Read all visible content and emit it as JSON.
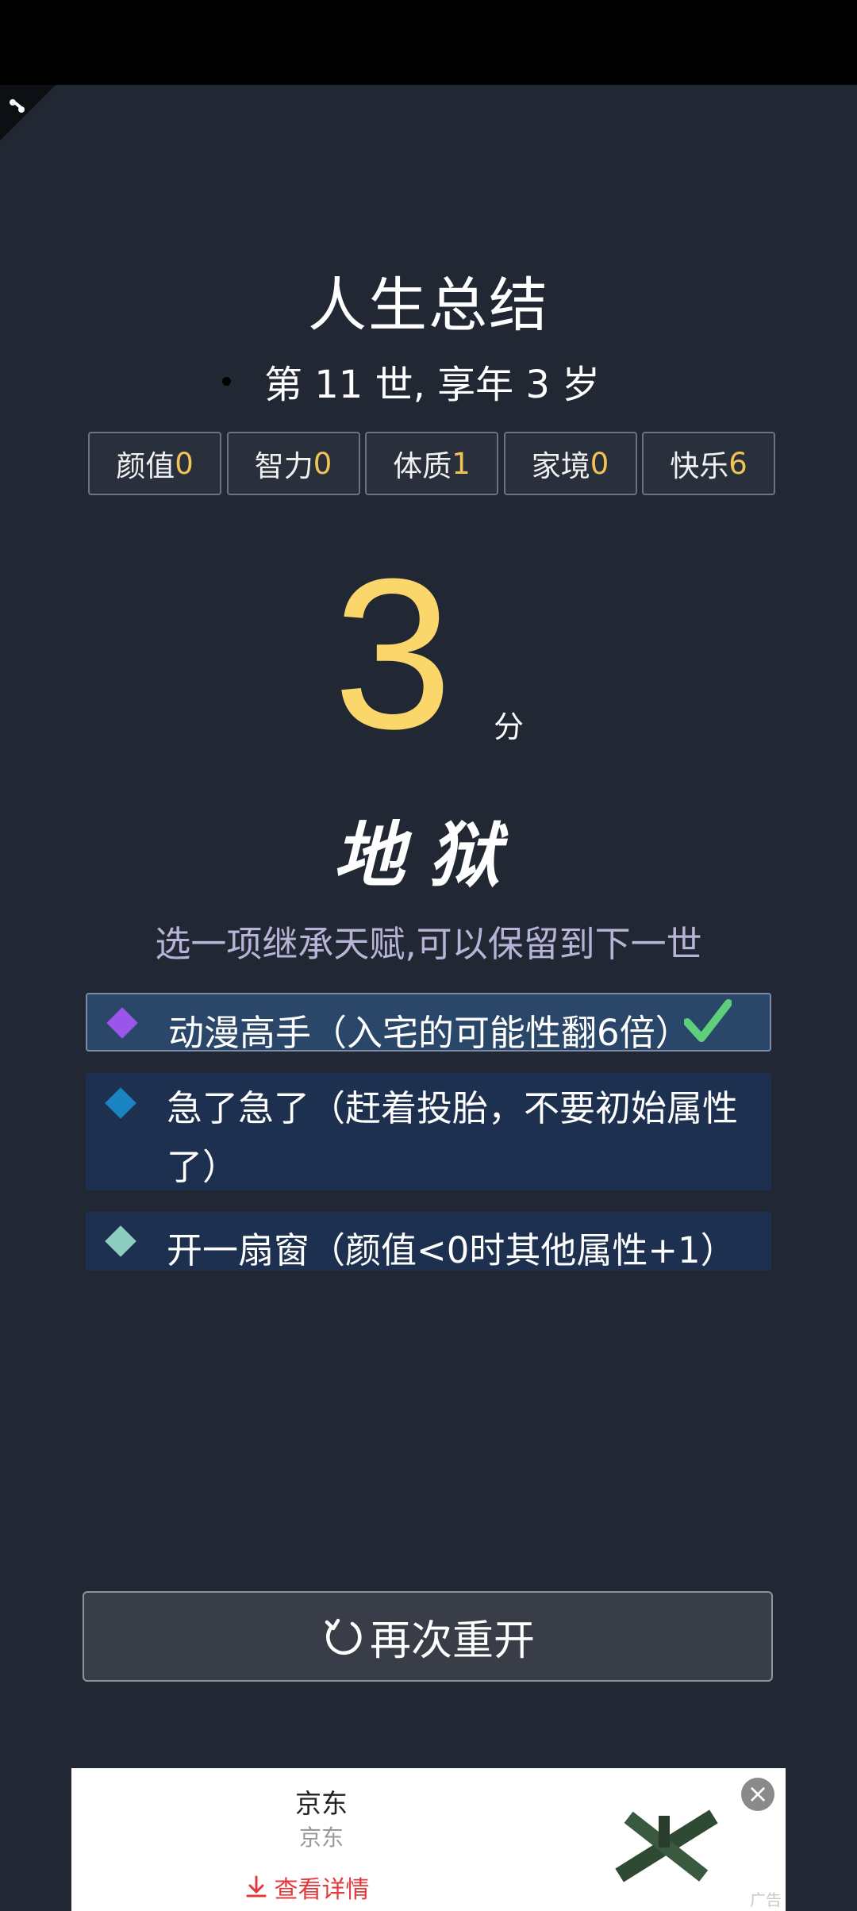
{
  "summary": {
    "title": "人生总结",
    "life_line": "第 11 世, 享年 3 岁"
  },
  "attributes": [
    {
      "label": "颜值",
      "value": "0"
    },
    {
      "label": "智力",
      "value": "0"
    },
    {
      "label": "体质",
      "value": "1"
    },
    {
      "label": "家境",
      "value": "0"
    },
    {
      "label": "快乐",
      "value": "6"
    }
  ],
  "score": {
    "value": "3",
    "unit": "分",
    "grade": "地狱"
  },
  "inherit": {
    "hint": "选一项继承天赋,可以保留到下一世",
    "talents": [
      {
        "text": "动漫高手（入宅的可能性翻6倍）",
        "color": "#9a55ea",
        "selected": true
      },
      {
        "text": "急了急了（赶着投胎，不要初始属性了）",
        "color": "#1a84c2",
        "selected": false
      },
      {
        "text": "开一扇窗（颜值<0时其他属性+1）",
        "color": "#8ccfc0",
        "selected": false
      }
    ]
  },
  "restart_button": {
    "label": "再次重开",
    "icon": "refresh-icon"
  },
  "ad": {
    "title": "京东",
    "subtitle": "京东",
    "link": "查看详情",
    "tag": "广告",
    "close_icon": "close-icon",
    "link_color": "#e4393c"
  },
  "colors": {
    "background": "#222833",
    "score": "#fbd66a",
    "attr_value": "#f0c354",
    "hint": "#b8b4d8"
  }
}
